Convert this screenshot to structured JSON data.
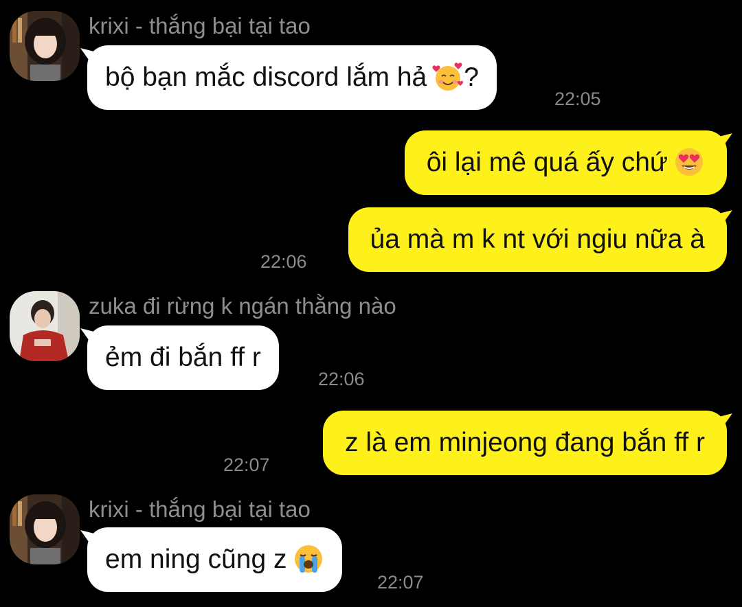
{
  "messages": [
    {
      "kind": "in",
      "sender": "krixi - thắng bại tại tao",
      "text": "bộ bạn mắc discord lắm hả",
      "emoji": "smiling-face-with-hearts-icon",
      "suffix": "?",
      "time": "22:05"
    },
    {
      "kind": "out",
      "text": "ôi lại mê quá ấy chứ",
      "emoji": "heart-eyes-icon",
      "time": ""
    },
    {
      "kind": "out",
      "text": "ủa mà m k nt với ngiu nữa à",
      "time": "22:06"
    },
    {
      "kind": "in",
      "sender": "zuka đi rừng k ngán thằng nào",
      "text": "ẻm đi bắn ff r",
      "time": "22:06"
    },
    {
      "kind": "out",
      "text": "z là em minjeong đang bắn ff r",
      "time": "22:07"
    },
    {
      "kind": "in",
      "sender": "krixi - thắng bại tại tao",
      "text": "em ning cũng z",
      "emoji": "loudly-crying-face-icon",
      "time": "22:07"
    }
  ],
  "colors": {
    "background": "#000000",
    "incoming_bubble": "#ffffff",
    "outgoing_bubble": "#fef01b",
    "sender_text": "#8e8e8e",
    "timestamp": "#8a8a8a"
  }
}
